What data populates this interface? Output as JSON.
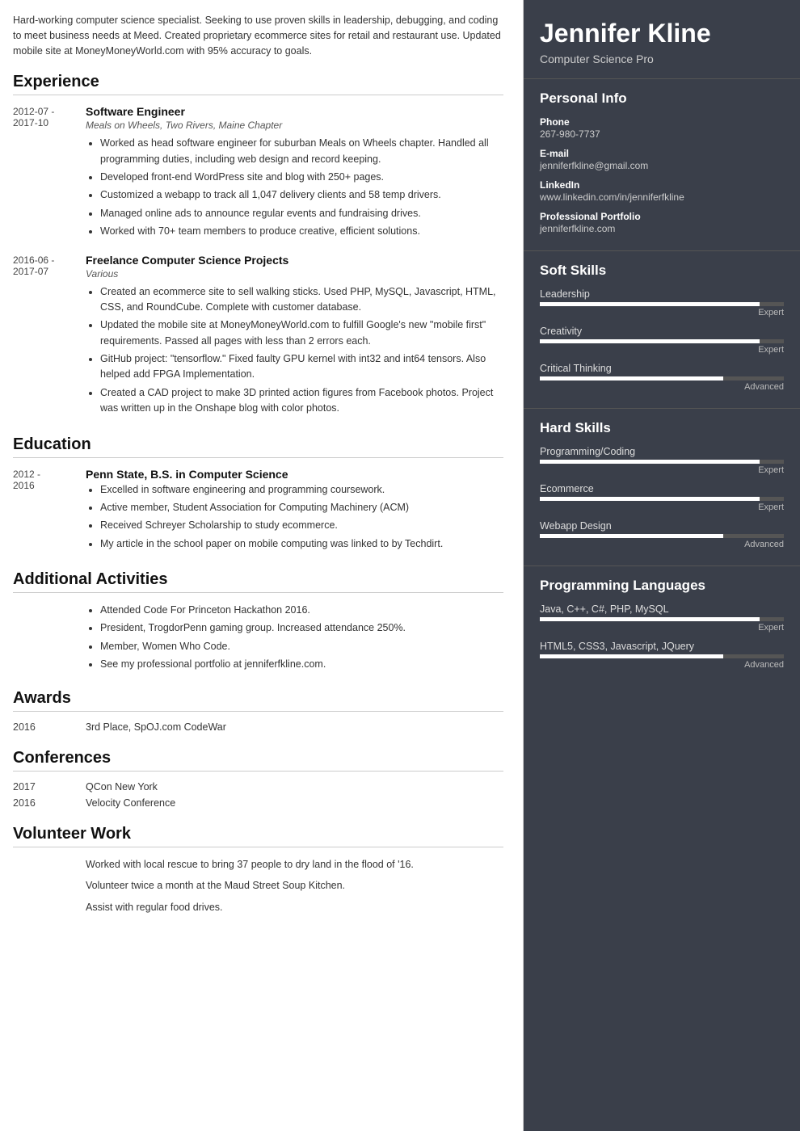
{
  "summary": "Hard-working computer science specialist. Seeking to use proven skills in leadership, debugging, and coding to meet business needs at Meed. Created proprietary ecommerce sites for retail and restaurant use. Updated mobile site at MoneyMoneyWorld.com with 95% accuracy to goals.",
  "sections": {
    "experience_title": "Experience",
    "education_title": "Education",
    "activities_title": "Additional Activities",
    "awards_title": "Awards",
    "conferences_title": "Conferences",
    "volunteer_title": "Volunteer Work"
  },
  "experience": [
    {
      "date": "2012-07 -\n2017-10",
      "title": "Software Engineer",
      "subtitle": "Meals on Wheels, Two Rivers, Maine Chapter",
      "bullets": [
        "Worked as head software engineer for suburban Meals on Wheels chapter. Handled all programming duties, including web design and record keeping.",
        "Developed front-end WordPress site and blog with 250+ pages.",
        "Customized a webapp to track all 1,047 delivery clients and 58 temp drivers.",
        "Managed online ads to announce regular events and fundraising drives.",
        "Worked with 70+ team members to produce creative, efficient solutions."
      ]
    },
    {
      "date": "2016-06 -\n2017-07",
      "title": "Freelance Computer Science Projects",
      "subtitle": "Various",
      "bullets": [
        "Created an ecommerce site to sell walking sticks. Used PHP, MySQL, Javascript, HTML, CSS, and RoundCube. Complete with customer database.",
        "Updated the mobile site at MoneyMoneyWorld.com to fulfill Google's new \"mobile first\" requirements. Passed all pages with less than 2 errors each.",
        "GitHub project: \"tensorflow.\" Fixed faulty GPU kernel with int32 and int64 tensors. Also helped add FPGA Implementation.",
        "Created a CAD project to make 3D printed action figures from Facebook photos. Project was written up in the Onshape blog with color photos."
      ]
    }
  ],
  "education": [
    {
      "date": "2012 -\n2016",
      "title": "Penn State, B.S. in Computer Science",
      "subtitle": "",
      "bullets": [
        "Excelled in software engineering and programming coursework.",
        "Active member, Student Association for Computing Machinery (ACM)",
        "Received Schreyer Scholarship to study ecommerce.",
        "My article in the school paper on mobile computing was linked to by Techdirt."
      ]
    }
  ],
  "activities_bullets": [
    "Attended Code For Princeton Hackathon 2016.",
    "President, TrogdorPenn gaming group. Increased attendance 250%.",
    "Member, Women Who Code.",
    "See my professional portfolio at jenniferfkline.com."
  ],
  "awards": [
    {
      "year": "2016",
      "text": "3rd Place, SpOJ.com CodeWar"
    }
  ],
  "conferences": [
    {
      "year": "2017",
      "text": "QCon New York"
    },
    {
      "year": "2016",
      "text": "Velocity Conference"
    }
  ],
  "volunteer": [
    "Worked with local rescue to bring 37 people to dry land in the flood of '16.",
    "Volunteer twice a month at the Maud Street Soup Kitchen.",
    "Assist with regular food drives."
  ],
  "right": {
    "name": "Jennifer Kline",
    "title": "Computer Science Pro",
    "personal_info_title": "Personal Info",
    "phone_label": "Phone",
    "phone": "267-980-7737",
    "email_label": "E-mail",
    "email": "jenniferfkline@gmail.com",
    "linkedin_label": "LinkedIn",
    "linkedin": "www.linkedin.com/in/jenniferfkline",
    "portfolio_label": "Professional Portfolio",
    "portfolio": "jenniferfkline.com",
    "soft_skills_title": "Soft Skills",
    "soft_skills": [
      {
        "name": "Leadership",
        "level_label": "Expert",
        "fill_pct": 90
      },
      {
        "name": "Creativity",
        "level_label": "Expert",
        "fill_pct": 90
      },
      {
        "name": "Critical Thinking",
        "level_label": "Advanced",
        "fill_pct": 75
      }
    ],
    "hard_skills_title": "Hard Skills",
    "hard_skills": [
      {
        "name": "Programming/Coding",
        "level_label": "Expert",
        "fill_pct": 90
      },
      {
        "name": "Ecommerce",
        "level_label": "Expert",
        "fill_pct": 90
      },
      {
        "name": "Webapp Design",
        "level_label": "Advanced",
        "fill_pct": 75
      }
    ],
    "prog_lang_title": "Programming Languages",
    "prog_langs": [
      {
        "name": "Java, C++, C#, PHP, MySQL",
        "level_label": "Expert",
        "fill_pct": 90
      },
      {
        "name": "HTML5, CSS3, Javascript, JQuery",
        "level_label": "Advanced",
        "fill_pct": 75
      }
    ]
  }
}
